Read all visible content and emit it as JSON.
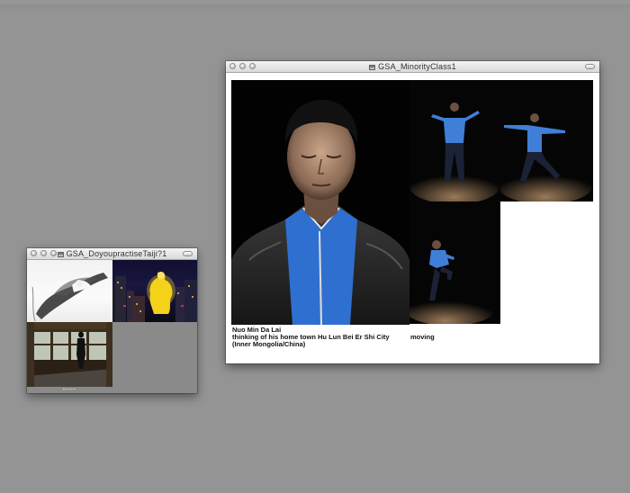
{
  "windows": [
    {
      "title": "GSA_DoyoupractiseTaiji?1",
      "tiles": [
        "ink-brush-figure-photo",
        "night-city-glowing-figure-photo",
        "room-silhouette-photo"
      ]
    },
    {
      "title": "GSA_MinorityClass1",
      "photos": [
        "portrait-photo",
        "back-view-photo",
        "stance-photo",
        "kick-photo"
      ],
      "caption": {
        "name": "Nuo Min Da Lai",
        "line2": "thinking of his home town Hu Lun Bei Er Shi City",
        "line3": "(Inner Mongolia/China)",
        "side": "moving"
      }
    }
  ],
  "colors": {
    "desktop": "#949494",
    "jacket_blue": "#2f6fd0",
    "glow_yellow": "#f4d21a"
  }
}
